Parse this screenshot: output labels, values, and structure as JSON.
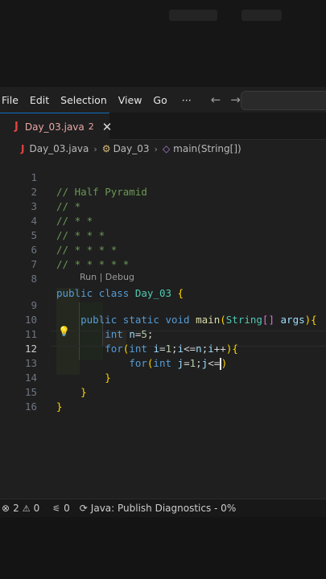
{
  "menu": {
    "items": [
      "File",
      "Edit",
      "Selection",
      "View",
      "Go",
      "···"
    ],
    "back_icon": "←",
    "forward_icon": "→"
  },
  "tab": {
    "icon": "J",
    "name": "Day_03.java",
    "problems": "2",
    "close": "✕"
  },
  "breadcrumbs": {
    "file_icon": "J",
    "file": "Day_03.java",
    "class_icon": "⚙",
    "class": "Day_03",
    "method_icon": "◇",
    "method": "main(String[])",
    "separator": "›"
  },
  "editor": {
    "current_line": 12,
    "codelens": "Run | Debug",
    "lines": [
      {
        "num": "1",
        "text": "// Half Pyramid"
      },
      {
        "num": "2",
        "text": "// *"
      },
      {
        "num": "3",
        "text": "// * *"
      },
      {
        "num": "4",
        "text": "// * * *"
      },
      {
        "num": "5",
        "text": "// * * * *"
      },
      {
        "num": "6",
        "text": "// * * * * *"
      },
      {
        "num": "7",
        "text": ""
      },
      {
        "num": "8",
        "text": "public class Day_03 {"
      },
      {
        "num": "9",
        "text": "    public static void main(String[] args){"
      },
      {
        "num": "10",
        "text": "        int n=5;"
      },
      {
        "num": "11",
        "text": "        for(int i=1;i<=n;i++){"
      },
      {
        "num": "12",
        "text": "            for(int j=1;j<=)"
      },
      {
        "num": "13",
        "text": "        }"
      },
      {
        "num": "14",
        "text": "    }"
      },
      {
        "num": "15",
        "text": "}"
      },
      {
        "num": "16",
        "text": ""
      }
    ]
  },
  "status": {
    "errors": "2",
    "warnings": "0",
    "ports": "0",
    "task": "Java: Publish Diagnostics - 0%"
  }
}
